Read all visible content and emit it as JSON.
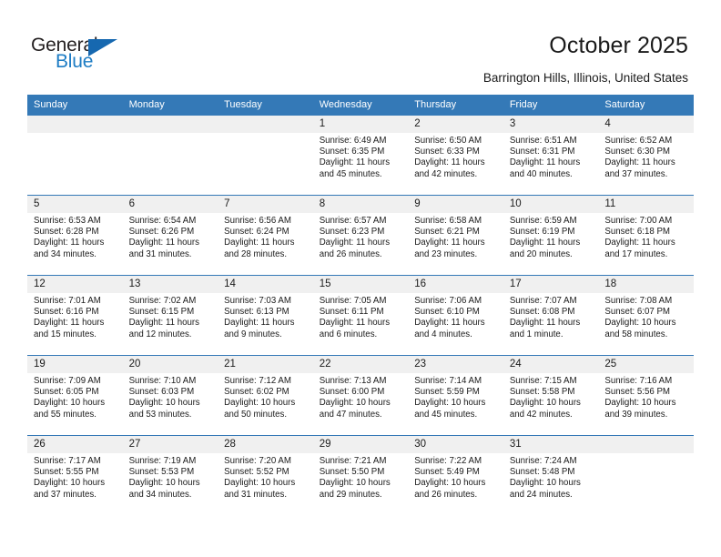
{
  "brand": {
    "name_part1": "General",
    "name_part2": "Blue",
    "accent_color": "#1668b0"
  },
  "header": {
    "title": "October 2025",
    "subtitle": "Barrington Hills, Illinois, United States"
  },
  "theme": {
    "header_row_bg": "#3479b7",
    "daynum_bg": "#f0f0f0",
    "text": "#1a1a1a"
  },
  "weekday_headers": [
    "Sunday",
    "Monday",
    "Tuesday",
    "Wednesday",
    "Thursday",
    "Friday",
    "Saturday"
  ],
  "weeks": [
    [
      {
        "day": "",
        "empty": true,
        "sunrise": "",
        "sunset": "",
        "daylight_line1": "",
        "daylight_line2": ""
      },
      {
        "day": "",
        "empty": true,
        "sunrise": "",
        "sunset": "",
        "daylight_line1": "",
        "daylight_line2": ""
      },
      {
        "day": "",
        "empty": true,
        "sunrise": "",
        "sunset": "",
        "daylight_line1": "",
        "daylight_line2": ""
      },
      {
        "day": "1",
        "sunrise": "Sunrise: 6:49 AM",
        "sunset": "Sunset: 6:35 PM",
        "daylight_line1": "Daylight: 11 hours",
        "daylight_line2": "and 45 minutes."
      },
      {
        "day": "2",
        "sunrise": "Sunrise: 6:50 AM",
        "sunset": "Sunset: 6:33 PM",
        "daylight_line1": "Daylight: 11 hours",
        "daylight_line2": "and 42 minutes."
      },
      {
        "day": "3",
        "sunrise": "Sunrise: 6:51 AM",
        "sunset": "Sunset: 6:31 PM",
        "daylight_line1": "Daylight: 11 hours",
        "daylight_line2": "and 40 minutes."
      },
      {
        "day": "4",
        "sunrise": "Sunrise: 6:52 AM",
        "sunset": "Sunset: 6:30 PM",
        "daylight_line1": "Daylight: 11 hours",
        "daylight_line2": "and 37 minutes."
      }
    ],
    [
      {
        "day": "5",
        "sunrise": "Sunrise: 6:53 AM",
        "sunset": "Sunset: 6:28 PM",
        "daylight_line1": "Daylight: 11 hours",
        "daylight_line2": "and 34 minutes."
      },
      {
        "day": "6",
        "sunrise": "Sunrise: 6:54 AM",
        "sunset": "Sunset: 6:26 PM",
        "daylight_line1": "Daylight: 11 hours",
        "daylight_line2": "and 31 minutes."
      },
      {
        "day": "7",
        "sunrise": "Sunrise: 6:56 AM",
        "sunset": "Sunset: 6:24 PM",
        "daylight_line1": "Daylight: 11 hours",
        "daylight_line2": "and 28 minutes."
      },
      {
        "day": "8",
        "sunrise": "Sunrise: 6:57 AM",
        "sunset": "Sunset: 6:23 PM",
        "daylight_line1": "Daylight: 11 hours",
        "daylight_line2": "and 26 minutes."
      },
      {
        "day": "9",
        "sunrise": "Sunrise: 6:58 AM",
        "sunset": "Sunset: 6:21 PM",
        "daylight_line1": "Daylight: 11 hours",
        "daylight_line2": "and 23 minutes."
      },
      {
        "day": "10",
        "sunrise": "Sunrise: 6:59 AM",
        "sunset": "Sunset: 6:19 PM",
        "daylight_line1": "Daylight: 11 hours",
        "daylight_line2": "and 20 minutes."
      },
      {
        "day": "11",
        "sunrise": "Sunrise: 7:00 AM",
        "sunset": "Sunset: 6:18 PM",
        "daylight_line1": "Daylight: 11 hours",
        "daylight_line2": "and 17 minutes."
      }
    ],
    [
      {
        "day": "12",
        "sunrise": "Sunrise: 7:01 AM",
        "sunset": "Sunset: 6:16 PM",
        "daylight_line1": "Daylight: 11 hours",
        "daylight_line2": "and 15 minutes."
      },
      {
        "day": "13",
        "sunrise": "Sunrise: 7:02 AM",
        "sunset": "Sunset: 6:15 PM",
        "daylight_line1": "Daylight: 11 hours",
        "daylight_line2": "and 12 minutes."
      },
      {
        "day": "14",
        "sunrise": "Sunrise: 7:03 AM",
        "sunset": "Sunset: 6:13 PM",
        "daylight_line1": "Daylight: 11 hours",
        "daylight_line2": "and 9 minutes."
      },
      {
        "day": "15",
        "sunrise": "Sunrise: 7:05 AM",
        "sunset": "Sunset: 6:11 PM",
        "daylight_line1": "Daylight: 11 hours",
        "daylight_line2": "and 6 minutes."
      },
      {
        "day": "16",
        "sunrise": "Sunrise: 7:06 AM",
        "sunset": "Sunset: 6:10 PM",
        "daylight_line1": "Daylight: 11 hours",
        "daylight_line2": "and 4 minutes."
      },
      {
        "day": "17",
        "sunrise": "Sunrise: 7:07 AM",
        "sunset": "Sunset: 6:08 PM",
        "daylight_line1": "Daylight: 11 hours",
        "daylight_line2": "and 1 minute."
      },
      {
        "day": "18",
        "sunrise": "Sunrise: 7:08 AM",
        "sunset": "Sunset: 6:07 PM",
        "daylight_line1": "Daylight: 10 hours",
        "daylight_line2": "and 58 minutes."
      }
    ],
    [
      {
        "day": "19",
        "sunrise": "Sunrise: 7:09 AM",
        "sunset": "Sunset: 6:05 PM",
        "daylight_line1": "Daylight: 10 hours",
        "daylight_line2": "and 55 minutes."
      },
      {
        "day": "20",
        "sunrise": "Sunrise: 7:10 AM",
        "sunset": "Sunset: 6:03 PM",
        "daylight_line1": "Daylight: 10 hours",
        "daylight_line2": "and 53 minutes."
      },
      {
        "day": "21",
        "sunrise": "Sunrise: 7:12 AM",
        "sunset": "Sunset: 6:02 PM",
        "daylight_line1": "Daylight: 10 hours",
        "daylight_line2": "and 50 minutes."
      },
      {
        "day": "22",
        "sunrise": "Sunrise: 7:13 AM",
        "sunset": "Sunset: 6:00 PM",
        "daylight_line1": "Daylight: 10 hours",
        "daylight_line2": "and 47 minutes."
      },
      {
        "day": "23",
        "sunrise": "Sunrise: 7:14 AM",
        "sunset": "Sunset: 5:59 PM",
        "daylight_line1": "Daylight: 10 hours",
        "daylight_line2": "and 45 minutes."
      },
      {
        "day": "24",
        "sunrise": "Sunrise: 7:15 AM",
        "sunset": "Sunset: 5:58 PM",
        "daylight_line1": "Daylight: 10 hours",
        "daylight_line2": "and 42 minutes."
      },
      {
        "day": "25",
        "sunrise": "Sunrise: 7:16 AM",
        "sunset": "Sunset: 5:56 PM",
        "daylight_line1": "Daylight: 10 hours",
        "daylight_line2": "and 39 minutes."
      }
    ],
    [
      {
        "day": "26",
        "sunrise": "Sunrise: 7:17 AM",
        "sunset": "Sunset: 5:55 PM",
        "daylight_line1": "Daylight: 10 hours",
        "daylight_line2": "and 37 minutes."
      },
      {
        "day": "27",
        "sunrise": "Sunrise: 7:19 AM",
        "sunset": "Sunset: 5:53 PM",
        "daylight_line1": "Daylight: 10 hours",
        "daylight_line2": "and 34 minutes."
      },
      {
        "day": "28",
        "sunrise": "Sunrise: 7:20 AM",
        "sunset": "Sunset: 5:52 PM",
        "daylight_line1": "Daylight: 10 hours",
        "daylight_line2": "and 31 minutes."
      },
      {
        "day": "29",
        "sunrise": "Sunrise: 7:21 AM",
        "sunset": "Sunset: 5:50 PM",
        "daylight_line1": "Daylight: 10 hours",
        "daylight_line2": "and 29 minutes."
      },
      {
        "day": "30",
        "sunrise": "Sunrise: 7:22 AM",
        "sunset": "Sunset: 5:49 PM",
        "daylight_line1": "Daylight: 10 hours",
        "daylight_line2": "and 26 minutes."
      },
      {
        "day": "31",
        "sunrise": "Sunrise: 7:24 AM",
        "sunset": "Sunset: 5:48 PM",
        "daylight_line1": "Daylight: 10 hours",
        "daylight_line2": "and 24 minutes."
      },
      {
        "day": "",
        "empty": true,
        "sunrise": "",
        "sunset": "",
        "daylight_line1": "",
        "daylight_line2": ""
      }
    ]
  ]
}
